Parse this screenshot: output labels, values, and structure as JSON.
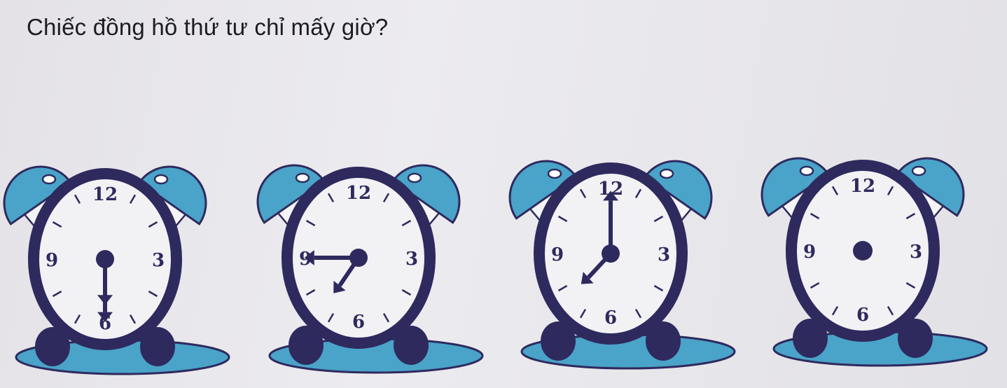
{
  "question": "Chiếc đồng hồ thứ tư chỉ mấy giờ?",
  "colors": {
    "navy": "#2e2a5e",
    "bell": "#4aa3c8",
    "face": "#f2f1f4"
  },
  "clock_numbers": [
    "12",
    "3",
    "6",
    "9"
  ],
  "clocks": [
    {
      "label": "clock-1",
      "hour_hand_position": 6.0,
      "minute_hand_position": 6.0,
      "has_hands": true
    },
    {
      "label": "clock-2",
      "hour_hand_position": 7.3,
      "minute_hand_position": 9.0,
      "has_hands": true
    },
    {
      "label": "clock-3",
      "hour_hand_position": 7.6,
      "minute_hand_position": 12.0,
      "has_hands": true
    },
    {
      "label": "clock-4",
      "has_hands": false
    }
  ]
}
